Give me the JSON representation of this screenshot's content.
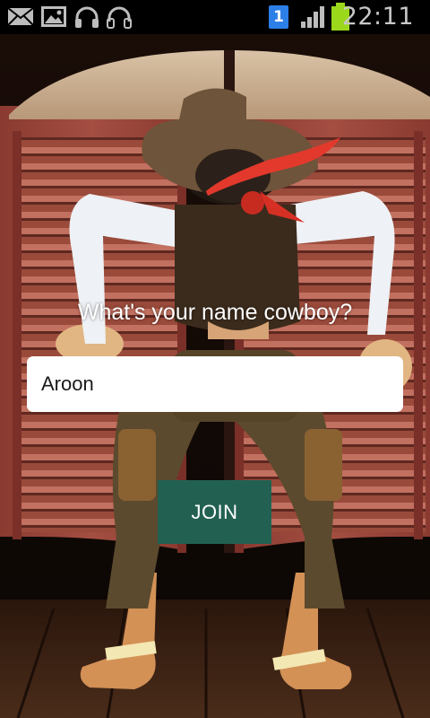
{
  "status_bar": {
    "time": "22:11",
    "sim_indicator": "1",
    "icons": [
      "mail-icon",
      "image-icon",
      "headphones-icon",
      "headphones-icon",
      "sim-icon",
      "signal-icon",
      "battery-icon"
    ]
  },
  "form": {
    "prompt": "What's your name cowboy?",
    "name_value": "Aroon",
    "join_label": "JOIN"
  },
  "colors": {
    "button": "#226152",
    "input_bg": "#ffffff",
    "battery": "#9bd81b",
    "sim_badge": "#2d7fe8"
  }
}
